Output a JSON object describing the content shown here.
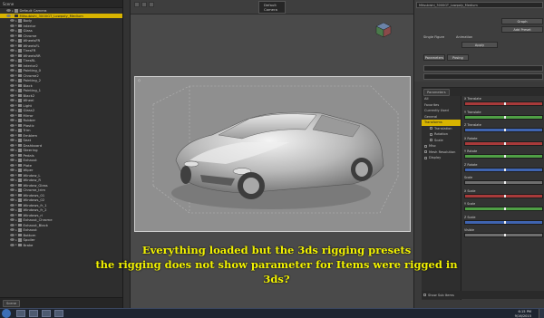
{
  "scene": {
    "tab": "Scene",
    "root_item": "Default Camera",
    "selected_item": "Mitsubishi_3000GT_Lowpoly_Medium",
    "items": [
      "Body",
      "Interior",
      "Glass",
      "Chrome",
      "WheelsFR",
      "WheelsFL",
      "TiresFR",
      "WheelsRR",
      "TiresRL",
      "Interior2",
      "Painting_0",
      "Chrome2",
      "Painting_2",
      "Black",
      "Painting_1",
      "Black2",
      "Wheel",
      "Light",
      "Glass2",
      "Mirror",
      "Rubber",
      "Plastic",
      "Trim",
      "Emblem",
      "Seat",
      "Dashboard",
      "Steering",
      "Pedals",
      "Exhaust",
      "Plate",
      "Wiper",
      "Window_L",
      "Window_R",
      "Window_Glass",
      "Chrome_trim",
      "Windows_01",
      "Windows_02",
      "Windows_fr_1",
      "Windows_fr_2",
      "Windows_rl",
      "Exhaust_Chrome",
      "Exhaust_Black",
      "Exhaust",
      "Bottom",
      "Spoiler",
      "Brake"
    ],
    "footer_tab": "Scene"
  },
  "viewport": {
    "camera_dropdown": "Default Camera",
    "label": "Perspective View"
  },
  "parameters": {
    "top_dropdown": "Mitsubishi_3000GT_Lowpoly_Medium",
    "tabs": [
      "Parameters",
      "Posing"
    ],
    "buttons": [
      "Graph",
      "Add Preset",
      "Apply"
    ],
    "options": [
      "Single Figure",
      "Animation"
    ],
    "cats": [
      "All",
      "Favorites",
      "Currently Used",
      "General",
      "Transforms",
      "Translation",
      "Rotation",
      "Scale",
      "Misc",
      "Mesh Resolution",
      "Display"
    ],
    "selected_cat": "Transforms",
    "sliders": [
      {
        "name": "X Translate",
        "color": "#a83a3a"
      },
      {
        "name": "Y Translate",
        "color": "#4f9f45"
      },
      {
        "name": "Z Translate",
        "color": "#3f64b0"
      },
      {
        "name": "X Rotate",
        "color": "#a83a3a"
      },
      {
        "name": "Y Rotate",
        "color": "#4f9f45"
      },
      {
        "name": "Z Rotate",
        "color": "#3f64b0"
      },
      {
        "name": "Scale",
        "color": "#6e6e6e"
      },
      {
        "name": "X Scale",
        "color": "#a83a3a"
      },
      {
        "name": "Y Scale",
        "color": "#4f9f45"
      },
      {
        "name": "Z Scale",
        "color": "#3f64b0"
      },
      {
        "name": "Visible",
        "color": "#6e6e6e"
      }
    ],
    "footer_check": "Show Sub Items"
  },
  "caption": {
    "line1": "Everything loaded but the 3ds rigging presets",
    "line2": "the rigging does not show parameter for Items were rigged in 3ds?"
  },
  "taskbar": {
    "time": "6:15 PM",
    "date": "9/16/2015"
  }
}
